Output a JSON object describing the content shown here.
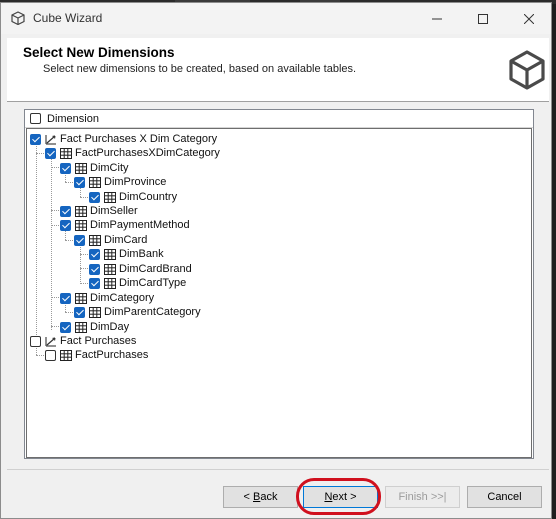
{
  "window": {
    "title": "Cube Wizard",
    "controls": [
      "minimize-icon",
      "maximize-icon",
      "close-icon"
    ]
  },
  "header": {
    "title": "Select New Dimensions",
    "subtitle": "Select new dimensions to be created, based on available tables."
  },
  "list": {
    "column_header": "Dimension",
    "rows": [
      {
        "label": "Fact Purchases X Dim Category",
        "checked": true,
        "icon": "cube-dimension-icon"
      },
      {
        "label": "FactPurchasesXDimCategory",
        "checked": true,
        "icon": "table-icon"
      },
      {
        "label": "DimCity",
        "checked": true,
        "icon": "table-icon"
      },
      {
        "label": "DimProvince",
        "checked": true,
        "icon": "table-icon"
      },
      {
        "label": "DimCountry",
        "checked": true,
        "icon": "table-icon"
      },
      {
        "label": "DimSeller",
        "checked": true,
        "icon": "table-icon"
      },
      {
        "label": "DimPaymentMethod",
        "checked": true,
        "icon": "table-icon"
      },
      {
        "label": "DimCard",
        "checked": true,
        "icon": "table-icon"
      },
      {
        "label": "DimBank",
        "checked": true,
        "icon": "table-icon"
      },
      {
        "label": "DimCardBrand",
        "checked": true,
        "icon": "table-icon"
      },
      {
        "label": "DimCardType",
        "checked": true,
        "icon": "table-icon"
      },
      {
        "label": "DimCategory",
        "checked": true,
        "icon": "table-icon"
      },
      {
        "label": "DimParentCategory",
        "checked": true,
        "icon": "table-icon"
      },
      {
        "label": "DimDay",
        "checked": true,
        "icon": "table-icon"
      },
      {
        "label": "Fact Purchases",
        "checked": false,
        "icon": "cube-dimension-icon"
      },
      {
        "label": "FactPurchases",
        "checked": false,
        "icon": "table-icon"
      }
    ]
  },
  "buttons": {
    "back": {
      "underlined": "B",
      "rest": "ack",
      "prefix": "< "
    },
    "next": {
      "underlined": "N",
      "rest": "ext >"
    },
    "finish": "Finish >>|",
    "cancel": "Cancel"
  },
  "colors": {
    "check_accent": "#1565c0",
    "annotation_circle": "#d0101e"
  }
}
